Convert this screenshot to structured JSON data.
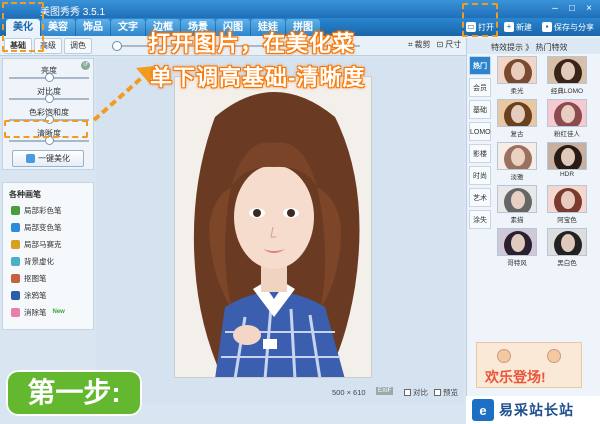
{
  "window": {
    "title": "美图秀秀 3.5.1"
  },
  "tabs": [
    {
      "label": "美化",
      "active": true
    },
    {
      "label": "美容",
      "active": false
    },
    {
      "label": "饰品",
      "active": false
    },
    {
      "label": "文字",
      "active": false
    },
    {
      "label": "边框",
      "active": false
    },
    {
      "label": "场景",
      "active": false
    },
    {
      "label": "闪图",
      "active": false
    },
    {
      "label": "娃娃",
      "active": false
    },
    {
      "label": "拼图",
      "active": false
    }
  ],
  "toolbar_right": {
    "open": "打开",
    "new": "新建",
    "save": "保存与分享"
  },
  "sub_tabs": [
    {
      "label": "基础",
      "active": true
    },
    {
      "label": "高级",
      "active": false
    },
    {
      "label": "调色",
      "active": false
    }
  ],
  "sub_tools": {
    "crop": "裁剪",
    "size": "尺寸"
  },
  "adjustments": [
    {
      "label": "亮度",
      "value": 0.5
    },
    {
      "label": "对比度",
      "value": 0.5
    },
    {
      "label": "色彩饱和度",
      "value": 0.5
    },
    {
      "label": "清晰度",
      "value": 0.5
    }
  ],
  "one_click": "一键美化",
  "brushes": {
    "heading": "各种画笔",
    "items": [
      {
        "label": "局部彩色笔",
        "color": "#4a9e3a"
      },
      {
        "label": "局部变色笔",
        "color": "#2e8bd8"
      },
      {
        "label": "局部马赛克",
        "color": "#d8a020"
      },
      {
        "label": "背景虚化",
        "color": "#4ab0c8"
      },
      {
        "label": "抠图笔",
        "color": "#c86040"
      },
      {
        "label": "涂鸦笔",
        "color": "#2a5ea8"
      },
      {
        "label": "消除笔",
        "color": "#e880a8",
        "badge": "New"
      }
    ]
  },
  "status": {
    "dims": "500 × 610",
    "exif": "EXIF",
    "compare": "对比",
    "preview": "预览"
  },
  "effects": {
    "header": "特效提示 》 热门特效",
    "categories": [
      {
        "label": "热门",
        "active": true
      },
      {
        "label": "会员",
        "active": false
      },
      {
        "label": "基础",
        "active": false
      },
      {
        "label": "LOMO",
        "active": false
      },
      {
        "label": "影楼",
        "active": false
      },
      {
        "label": "时尚",
        "active": false
      },
      {
        "label": "艺术",
        "active": false
      },
      {
        "label": "涂失",
        "active": false
      }
    ],
    "items": [
      {
        "label": "柔光"
      },
      {
        "label": "经典LOMO"
      },
      {
        "label": "复古"
      },
      {
        "label": "粉红佳人"
      },
      {
        "label": "淡雅"
      },
      {
        "label": "HDR"
      },
      {
        "label": "素描"
      },
      {
        "label": "阿宝色"
      },
      {
        "label": "哥特风"
      },
      {
        "label": "黑白色"
      }
    ]
  },
  "ad": {
    "text": "欢乐登场!"
  },
  "watermark": {
    "text": "易采站长站"
  },
  "overlay": {
    "callout_line1": "打开图片，在美化菜",
    "callout_line2": "单下调高基础-清晰度",
    "step": "第一步:"
  }
}
